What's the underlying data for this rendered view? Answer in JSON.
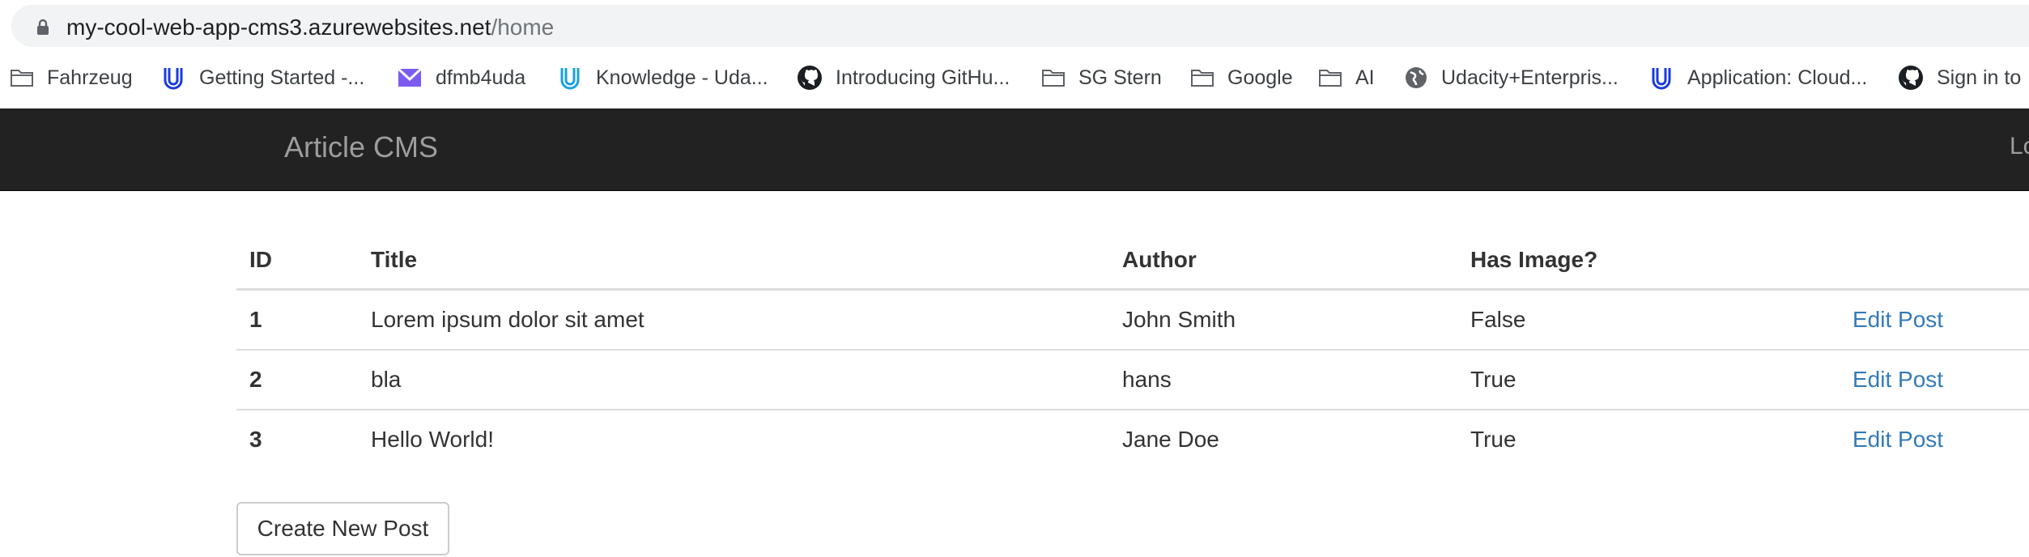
{
  "browser": {
    "url_host": "my-cool-web-app-cms3.azurewebsites.net",
    "url_path": "/home",
    "bookmarks": [
      {
        "label": "Fahrzeug",
        "icon": "folder-icon"
      },
      {
        "label": "Getting Started -...",
        "icon": "udacity-icon"
      },
      {
        "label": "dfmb4uda",
        "icon": "mail-icon"
      },
      {
        "label": "Knowledge - Uda...",
        "icon": "udacity-icon"
      },
      {
        "label": "Introducing GitHu...",
        "icon": "github-icon"
      },
      {
        "label": "SG Stern",
        "icon": "folder-icon"
      },
      {
        "label": "Google",
        "icon": "folder-icon"
      },
      {
        "label": "AI",
        "icon": "folder-icon"
      },
      {
        "label": "Udacity+Enterpris...",
        "icon": "globe-icon"
      },
      {
        "label": "Application: Cloud...",
        "icon": "udacity-icon"
      },
      {
        "label": "Sign in to",
        "icon": "github-icon"
      }
    ]
  },
  "navbar": {
    "brand": "Article CMS",
    "right_link": "Lo"
  },
  "table": {
    "headers": [
      "ID",
      "Title",
      "Author",
      "Has Image?"
    ],
    "rows": [
      {
        "id": "1",
        "title": "Lorem ipsum dolor sit amet",
        "author": "John Smith",
        "has_image": "False",
        "action": "Edit Post"
      },
      {
        "id": "2",
        "title": "bla",
        "author": "hans",
        "has_image": "True",
        "action": "Edit Post"
      },
      {
        "id": "3",
        "title": "Hello World!",
        "author": "Jane Doe",
        "has_image": "True",
        "action": "Edit Post"
      }
    ]
  },
  "create_button": "Create New Post",
  "colors": {
    "navbar_bg": "#222222",
    "brand_text": "#9d9d9d",
    "link": "#337ab7",
    "omnibox_bg": "#f1f3f4"
  }
}
